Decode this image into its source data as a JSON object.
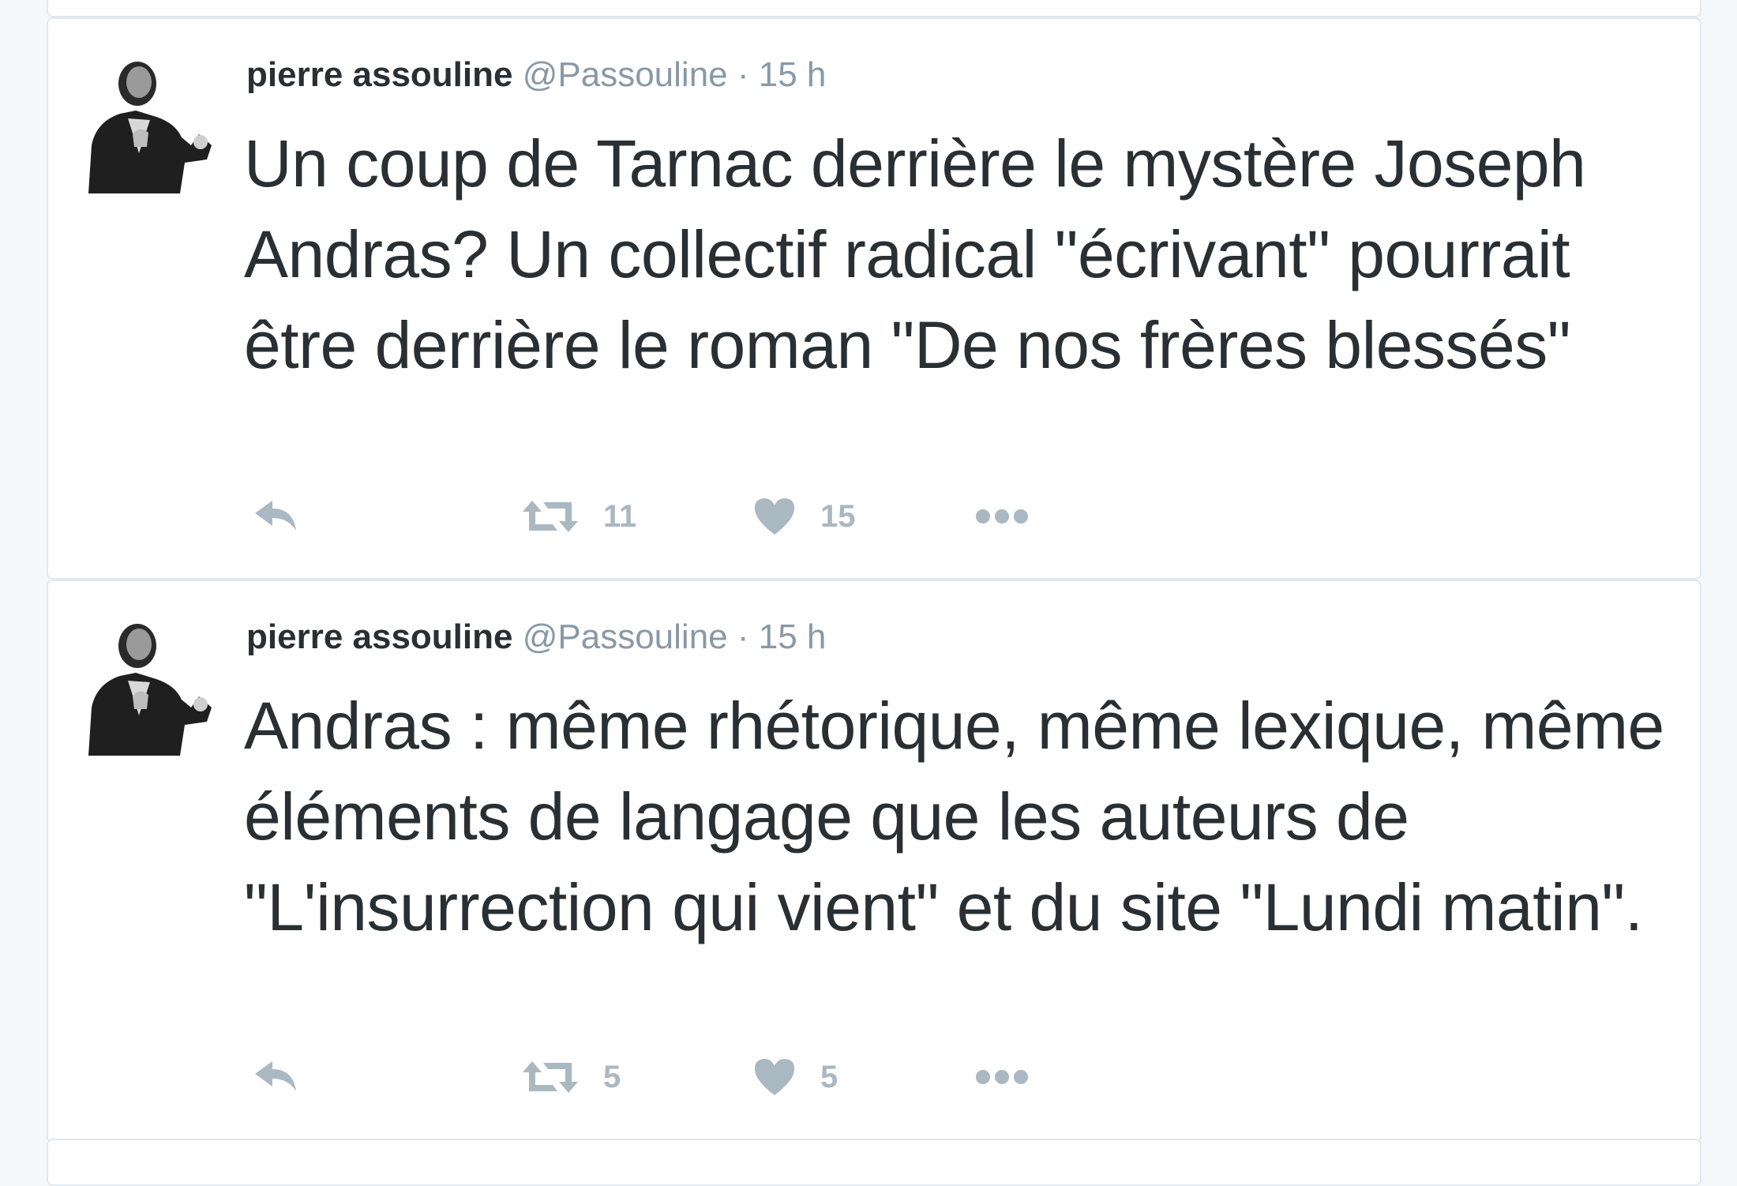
{
  "tweets": [
    {
      "author": {
        "name": "pierre assouline",
        "handle": "@Passouline",
        "avatar_icon": "author-photo"
      },
      "separator": "·",
      "time": "15 h",
      "text": "Un coup de Tarnac derrière le mystère Joseph Andras? Un collectif radical \"écrivant\" pourrait être derrière le roman \"De nos frères blessés\"",
      "actions": {
        "reply_icon": "reply-icon",
        "retweet_icon": "retweet-icon",
        "retweet_count": "11",
        "like_icon": "heart-icon",
        "like_count": "15",
        "more_icon": "more-dots-icon"
      }
    },
    {
      "author": {
        "name": "pierre assouline",
        "handle": "@Passouline",
        "avatar_icon": "author-photo"
      },
      "separator": "·",
      "time": "15 h",
      "text": "Andras : même rhétorique, même lexique, même éléments de langage que les auteurs de \"L'insurrection qui vient\" et du site \"Lundi matin\".",
      "actions": {
        "reply_icon": "reply-icon",
        "retweet_icon": "retweet-icon",
        "retweet_count": "5",
        "like_icon": "heart-icon",
        "like_count": "5",
        "more_icon": "more-dots-icon"
      }
    }
  ],
  "colors": {
    "background": "#f5f8fa",
    "card": "#ffffff",
    "border": "#e1e8ed",
    "text": "#292f33",
    "muted": "#8899a6",
    "action": "#aab8c2"
  }
}
